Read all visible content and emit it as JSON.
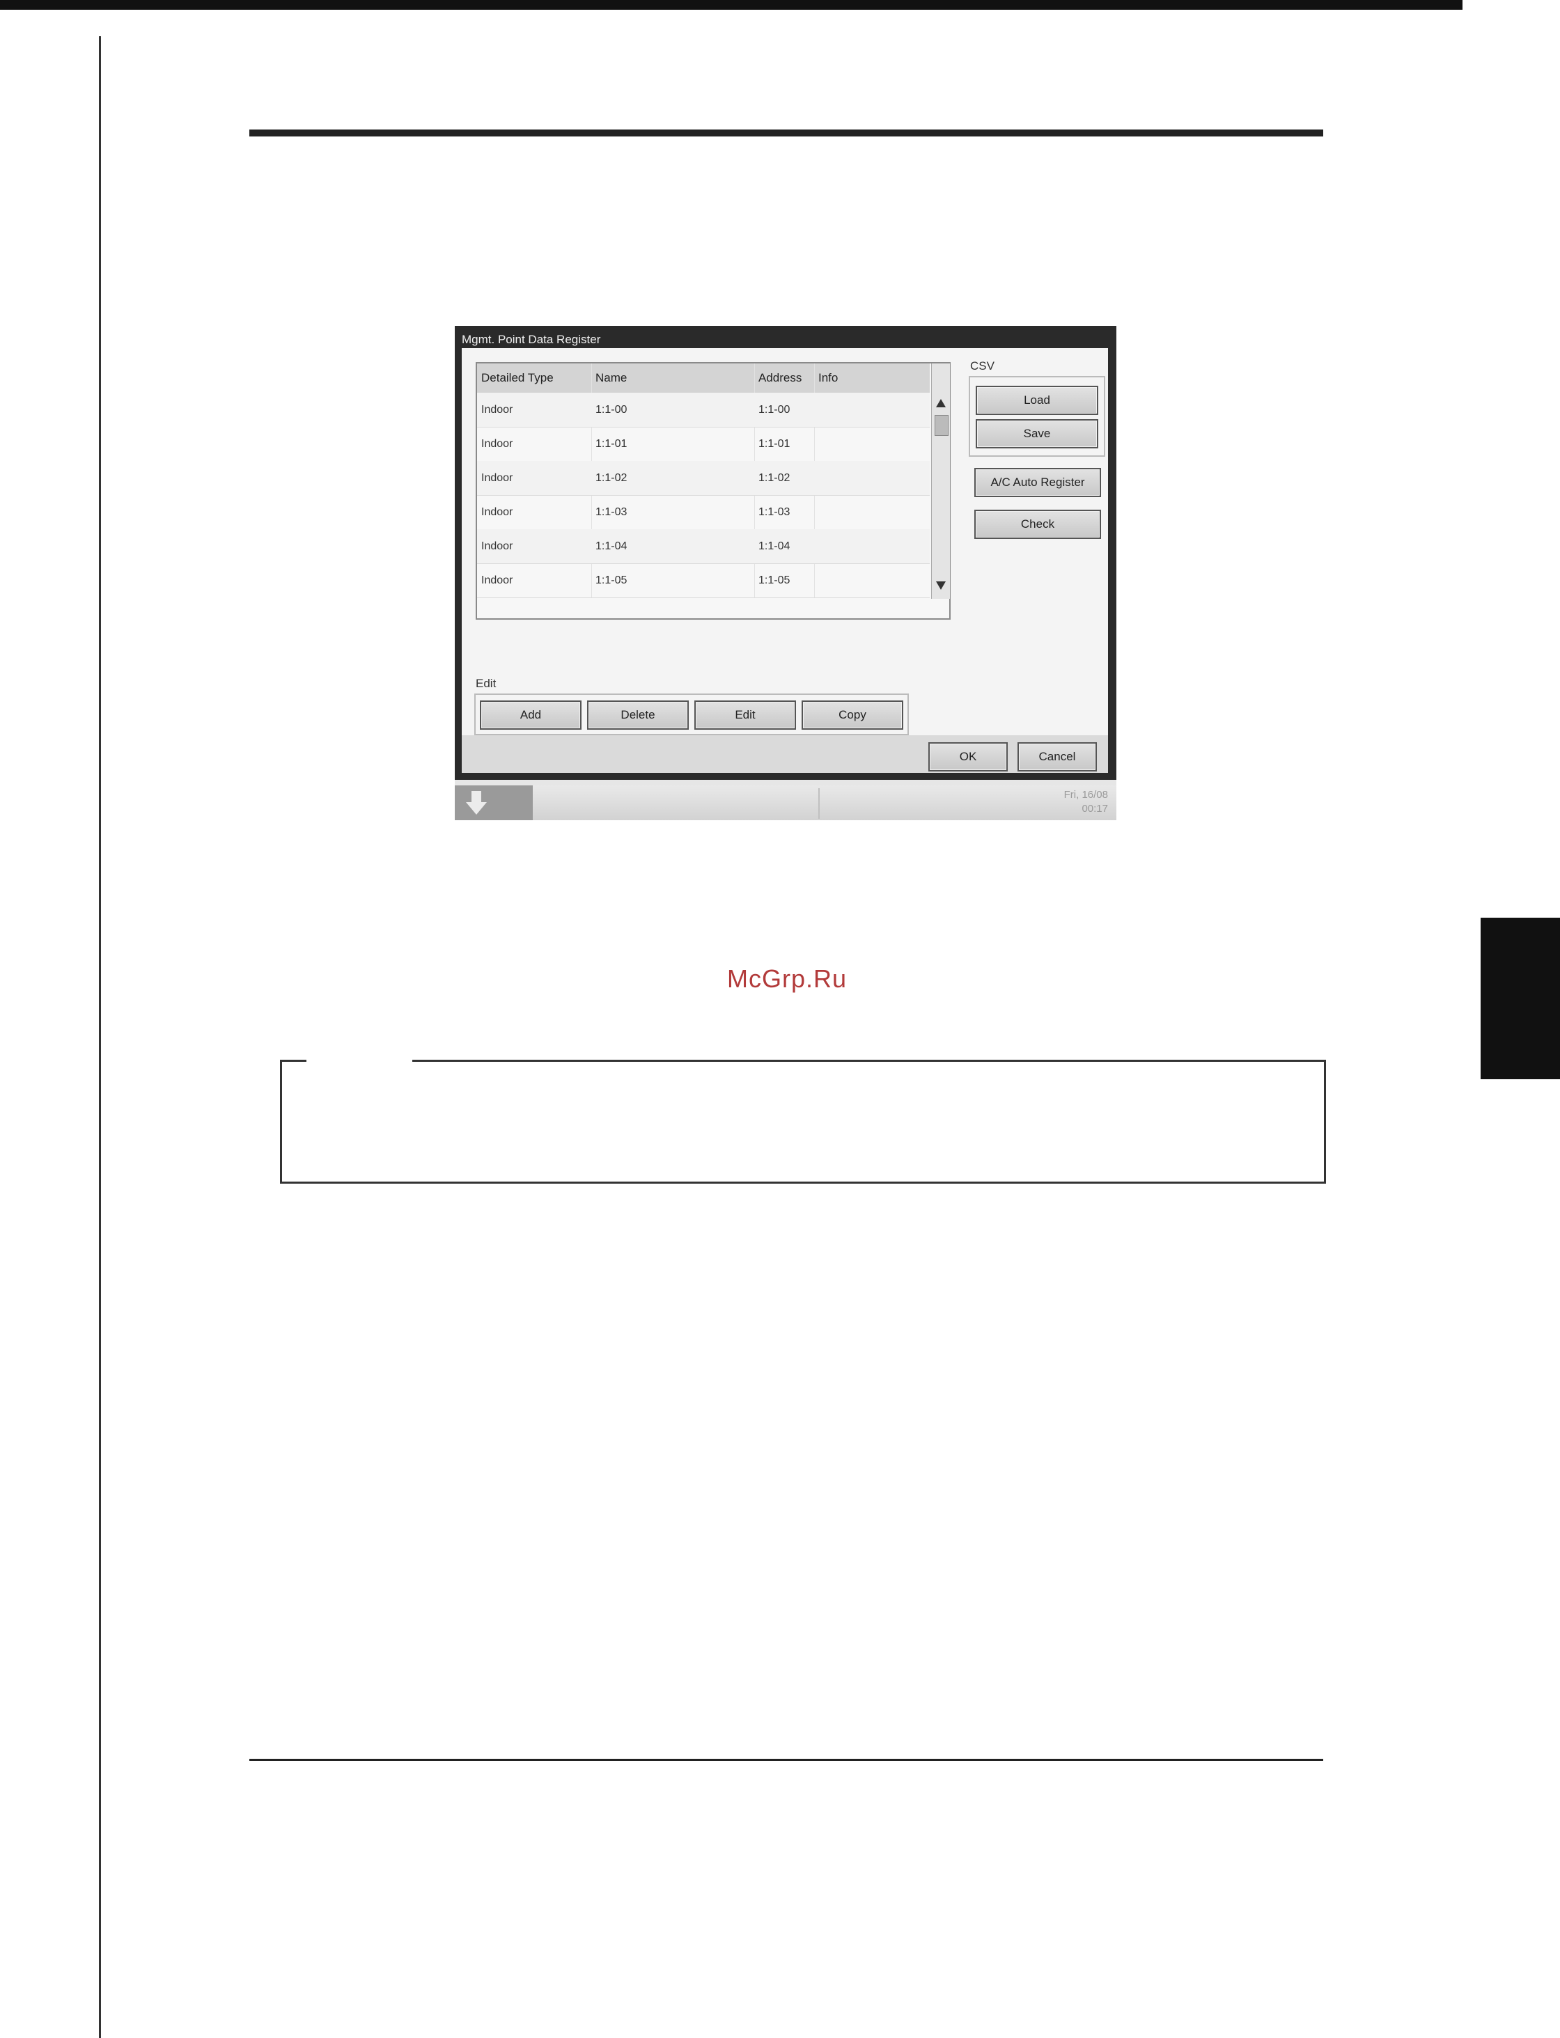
{
  "dialog": {
    "title": "Mgmt. Point Data Register"
  },
  "table": {
    "columns": [
      "Detailed Type",
      "Name",
      "Address",
      "Info"
    ],
    "rows": [
      {
        "type": "Indoor",
        "name": "1:1-00",
        "address": "1:1-00",
        "info": ""
      },
      {
        "type": "Indoor",
        "name": "1:1-01",
        "address": "1:1-01",
        "info": ""
      },
      {
        "type": "Indoor",
        "name": "1:1-02",
        "address": "1:1-02",
        "info": ""
      },
      {
        "type": "Indoor",
        "name": "1:1-03",
        "address": "1:1-03",
        "info": ""
      },
      {
        "type": "Indoor",
        "name": "1:1-04",
        "address": "1:1-04",
        "info": ""
      },
      {
        "type": "Indoor",
        "name": "1:1-05",
        "address": "1:1-05",
        "info": ""
      }
    ],
    "scroll_up_icon": "triangle-up",
    "scroll_down_icon": "triangle-down"
  },
  "csv": {
    "label": "CSV",
    "load": "Load",
    "save": "Save"
  },
  "side": {
    "auto_register": "A/C Auto Register",
    "check": "Check"
  },
  "edit": {
    "label": "Edit",
    "add": "Add",
    "delete": "Delete",
    "edit": "Edit",
    "copy": "Copy"
  },
  "footer": {
    "ok": "OK",
    "cancel": "Cancel"
  },
  "status_bar": {
    "date": "Fri, 16/08",
    "time": "00:17"
  },
  "watermark": "McGrp.Ru"
}
